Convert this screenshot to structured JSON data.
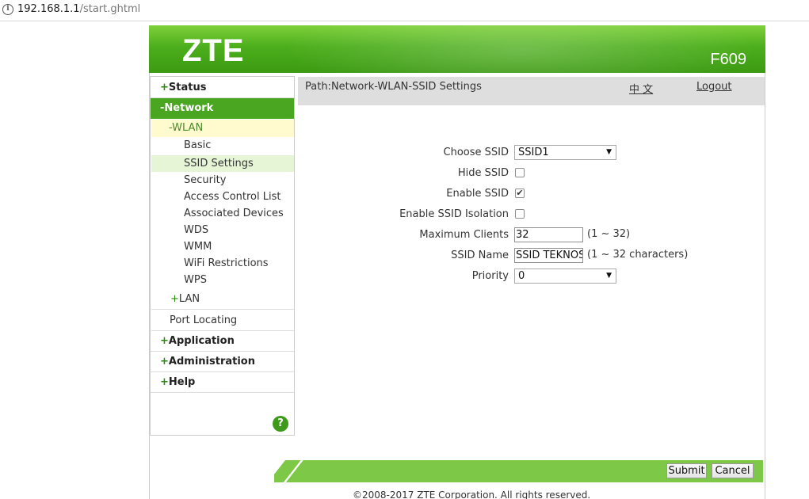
{
  "address_bar": {
    "host": "192.168.1.1",
    "path": "/start.ghtml"
  },
  "header": {
    "logo": "ZTE",
    "model": "F609"
  },
  "sidebar": {
    "status": {
      "sign": "+",
      "label": "Status"
    },
    "network": {
      "sign": "-",
      "label": "Network"
    },
    "wlan": "-WLAN",
    "wlan_items": [
      "Basic",
      "SSID Settings",
      "Security",
      "Access Control List",
      "Associated Devices",
      "WDS",
      "WMM",
      "WiFi Restrictions",
      "WPS"
    ],
    "lan": {
      "sign": "+",
      "label": "LAN"
    },
    "port_locating": "Port Locating",
    "application": {
      "sign": "+",
      "label": "Application"
    },
    "administration": {
      "sign": "+",
      "label": "Administration"
    },
    "help": {
      "sign": "+",
      "label": "Help"
    },
    "help_icon": "?"
  },
  "pathbar": {
    "path": "Path:Network-WLAN-SSID Settings",
    "language": "中 文",
    "logout": "Logout"
  },
  "form": {
    "choose_ssid": {
      "label": "Choose SSID",
      "value": "SSID1"
    },
    "hide_ssid": {
      "label": "Hide SSID",
      "checked": false
    },
    "enable_ssid": {
      "label": "Enable SSID",
      "checked": true
    },
    "enable_isolation": {
      "label": "Enable SSID Isolation",
      "checked": false
    },
    "max_clients": {
      "label": "Maximum Clients",
      "value": "32",
      "hint": "(1 ~ 32)"
    },
    "ssid_name": {
      "label": "SSID Name",
      "value": "SSID TEKNOS",
      "hint": "(1 ~ 32 characters)"
    },
    "priority": {
      "label": "Priority",
      "value": "0"
    },
    "checkmark": "✔",
    "caret": "▼"
  },
  "buttons": {
    "submit": "Submit",
    "cancel": "Cancel"
  },
  "footer": {
    "copyright": "©2008-2017 ZTE Corporation. All rights reserved."
  },
  "colors": {
    "brand_green": "#4cae1c",
    "active_green": "#4aa520",
    "footer_green": "#7dc846"
  }
}
